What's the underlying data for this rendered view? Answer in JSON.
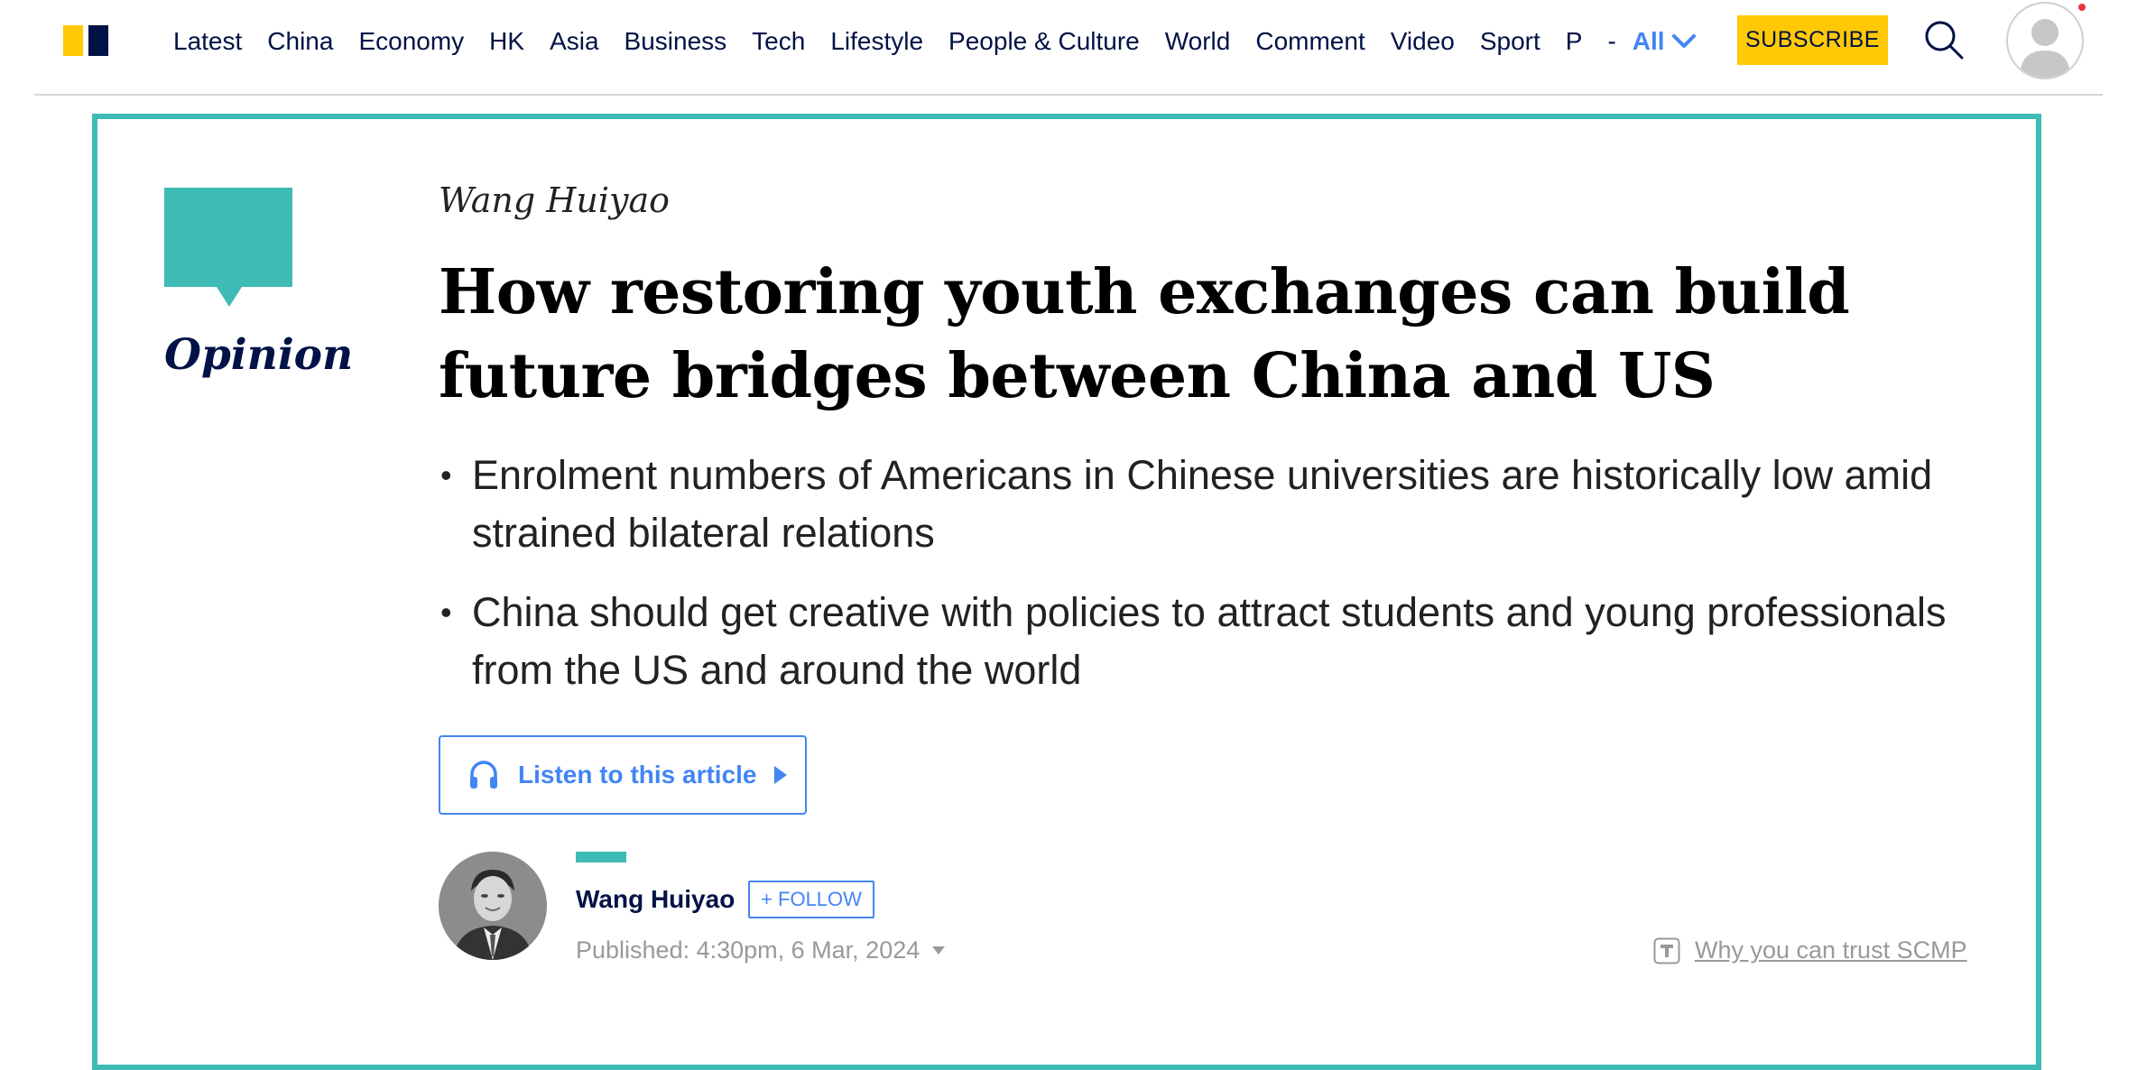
{
  "header": {
    "nav_items": [
      "Latest",
      "China",
      "Economy",
      "HK",
      "Asia",
      "Business",
      "Tech",
      "Lifestyle",
      "People & Culture",
      "World",
      "Comment",
      "Video",
      "Sport",
      "P"
    ],
    "separator": "-",
    "all_label": "All",
    "subscribe_label": "SUBSCRIBE"
  },
  "article": {
    "section_label": "Opinion",
    "author_top": "Wang Huiyao",
    "headline": "How restoring youth exchanges can build future bridges between China and US",
    "summary_points": [
      "Enrolment numbers of Americans in Chinese universities are historically low amid strained bilateral relations",
      "China should get creative with policies to attract students and young professionals from the US and around the world"
    ],
    "listen_label": "Listen to this article",
    "author_name": "Wang Huiyao",
    "follow_label": "+ FOLLOW",
    "published": "Published: 4:30pm, 6 Mar, 2024",
    "trust_label": "Why you can trust SCMP"
  },
  "colors": {
    "brand_navy": "#001246",
    "brand_yellow": "#ffca05",
    "accent_teal": "#3ebbb4",
    "link_blue": "#4285f4"
  },
  "icons": [
    "search-icon",
    "user-icon",
    "chevron-down-icon",
    "headphones-icon",
    "play-icon",
    "caret-down-icon",
    "trust-icon",
    "opinion-speech-bubble-icon"
  ]
}
